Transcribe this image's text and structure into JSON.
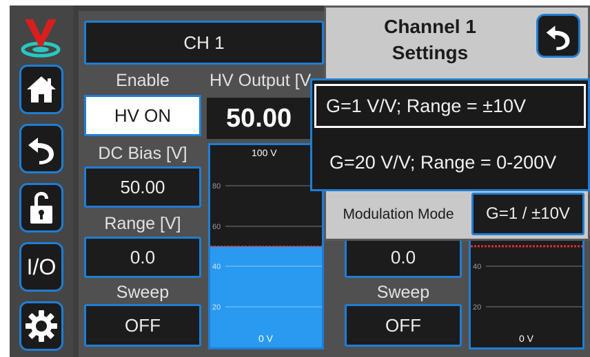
{
  "sidebar": {
    "items": [
      {
        "name": "logo",
        "icon": "logo-icon"
      },
      {
        "name": "home",
        "icon": "home-icon"
      },
      {
        "name": "back",
        "icon": "back-arrow-icon"
      },
      {
        "name": "unlock",
        "icon": "unlock-icon"
      },
      {
        "name": "io",
        "label": "I/O"
      },
      {
        "name": "settings",
        "icon": "gear-icon"
      }
    ]
  },
  "left_channel": {
    "title": "CH 1",
    "enable_label": "Enable",
    "enable_value": "HV ON",
    "hv_output_label": "HV Output [V",
    "hv_output_value": "50.00",
    "dc_bias_label": "DC Bias [V]",
    "dc_bias_value": "50.00",
    "range_label": "Range [V]",
    "range_value": "0.0",
    "sweep_label": "Sweep",
    "sweep_value": "OFF",
    "chart": {
      "top_label": "100 V",
      "bottom_label": "0 V",
      "ticks": [
        "80",
        "60",
        "40",
        "20"
      ],
      "level_fraction": 0.5
    }
  },
  "right_channel": {
    "range_value": "0.0",
    "sweep_label": "Sweep",
    "sweep_value": "OFF",
    "chart": {
      "bottom_label": "0 V",
      "ticks": [
        "40",
        "20"
      ]
    }
  },
  "settings_panel": {
    "title_line1": "Channel 1",
    "title_line2": "Settings",
    "back_icon": "back-arrow-icon",
    "options": [
      "G=1 V/V; Range = ±10V",
      "G=20 V/V; Range = 0-200V"
    ],
    "modulation_label": "Modulation Mode",
    "modulation_value": "G=1 / ±10V"
  },
  "colors": {
    "accent": "#1f7ed6",
    "level_fill": "#2a9af0",
    "level_marker": "#e03030",
    "background": "#3e3e3e"
  }
}
